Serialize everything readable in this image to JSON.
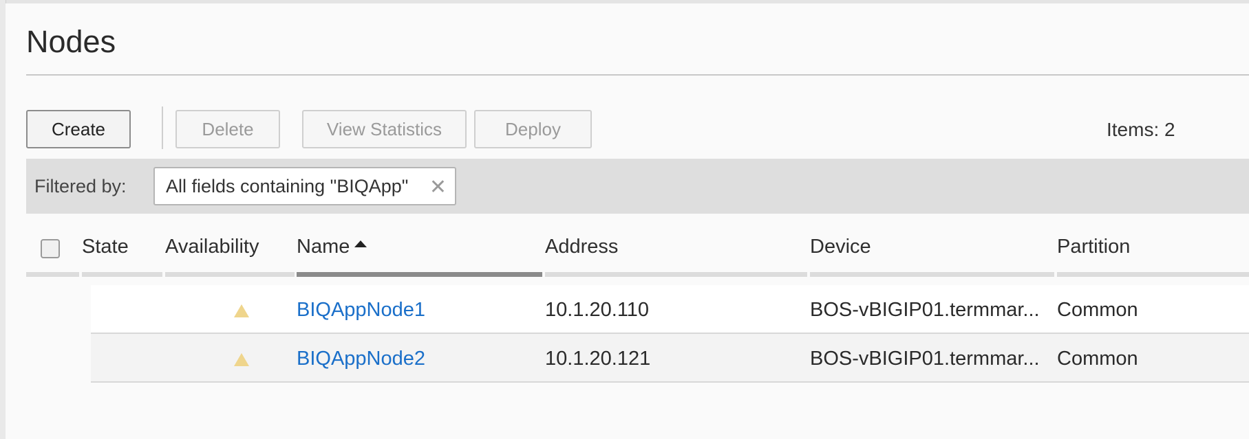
{
  "page": {
    "title": "Nodes"
  },
  "toolbar": {
    "create_label": "Create",
    "delete_label": "Delete",
    "view_statistics_label": "View Statistics",
    "deploy_label": "Deploy",
    "items_count": "Items: 2"
  },
  "filter": {
    "label": "Filtered by:",
    "chip_text": "All fields containing \"BIQApp\"",
    "chip_close_icon": "close-icon"
  },
  "table": {
    "columns": [
      "State",
      "Availability",
      "Name",
      "Address",
      "Device",
      "Partition"
    ],
    "sorted_column": "Name",
    "sort_direction": "ascending",
    "rows": [
      {
        "state": "",
        "availability": "warning-triangle-icon",
        "name": "BIQAppNode1",
        "address": "10.1.20.110",
        "device": "BOS-vBIGIP01.termmar...",
        "partition": "Common"
      },
      {
        "state": "",
        "availability": "warning-triangle-icon",
        "name": "BIQAppNode2",
        "address": "10.1.20.121",
        "device": "BOS-vBIGIP01.termmar...",
        "partition": "Common"
      }
    ]
  },
  "colors": {
    "link": "#1a6fc9",
    "warning_icon": "#efd58c",
    "sorted_column_bar": "#8a8a8a"
  }
}
